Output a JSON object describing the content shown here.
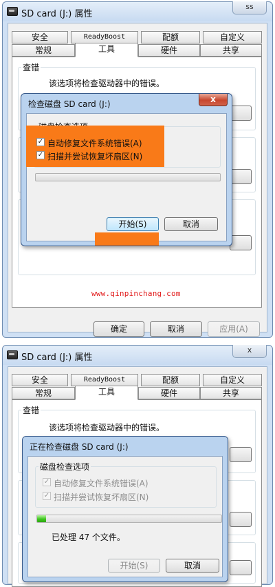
{
  "watermark": "www.qinpinchang.com",
  "accent_orange": "#f97a18",
  "progress_green": "#3ec51f",
  "screen1": {
    "window": {
      "title": "SD card (J:) 属性",
      "close_label": "ss",
      "tabs_row1": [
        "安全",
        "ReadyBoost",
        "配额",
        "自定义"
      ],
      "tabs_row2": [
        "常规",
        "工具",
        "硬件",
        "共享"
      ],
      "active_tab": "工具",
      "group_title": "查错",
      "group_desc": "该选项将检查驱动器中的错误。",
      "buttons": {
        "ok": "确定",
        "cancel": "取消",
        "apply": "应用(A)"
      }
    },
    "dialog": {
      "title": "检查磁盘 SD card (J:)",
      "close_label": "x",
      "group_label": "磁盘检查选项",
      "options": [
        {
          "label": "自动修复文件系统错误(A)",
          "checked": true
        },
        {
          "label": "扫描并尝试恢复坏扇区(N)",
          "checked": true
        }
      ],
      "progress_percent": 0,
      "buttons": {
        "start": "开始(S)",
        "cancel": "取消"
      }
    }
  },
  "screen2": {
    "window": {
      "title": "SD card (J:) 属性",
      "close_label": "x",
      "tabs_row1": [
        "安全",
        "ReadyBoost",
        "配额",
        "自定义"
      ],
      "tabs_row2": [
        "常规",
        "工具",
        "硬件",
        "共享"
      ],
      "active_tab": "工具",
      "group_title": "查错",
      "group_desc": "该选项将检查驱动器中的错误。"
    },
    "dialog": {
      "title": "正在检查磁盘 SD card (J:)",
      "group_label": "磁盘检查选项",
      "options": [
        {
          "label": "自动修复文件系统错误(A)",
          "checked": true,
          "disabled": true
        },
        {
          "label": "扫描并尝试恢复坏扇区(N)",
          "checked": true,
          "disabled": true
        }
      ],
      "progress_percent": 5,
      "status": "已处理 47 个文件。",
      "buttons": {
        "start": "开始(S)",
        "cancel": "取消"
      }
    }
  }
}
